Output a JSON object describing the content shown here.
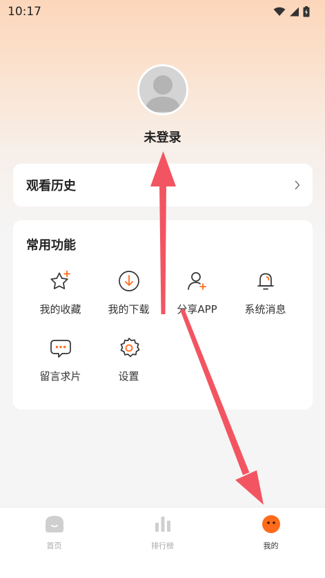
{
  "status_bar": {
    "time": "10:17"
  },
  "profile": {
    "username": "未登录"
  },
  "history": {
    "title": "观看历史"
  },
  "features": {
    "title": "常用功能",
    "items": [
      {
        "label": "我的收藏",
        "icon": "star-plus-icon"
      },
      {
        "label": "我的下载",
        "icon": "download-icon"
      },
      {
        "label": "分享APP",
        "icon": "user-plus-icon"
      },
      {
        "label": "系统消息",
        "icon": "bell-icon"
      },
      {
        "label": "留言求片",
        "icon": "message-icon"
      },
      {
        "label": "设置",
        "icon": "gear-icon"
      }
    ]
  },
  "tabbar": {
    "tabs": [
      {
        "label": "首页",
        "icon": "home-icon",
        "active": false
      },
      {
        "label": "排行榜",
        "icon": "ranking-icon",
        "active": false
      },
      {
        "label": "我的",
        "icon": "mine-icon",
        "active": true
      }
    ]
  },
  "colors": {
    "accent": "#ff6b1a",
    "annotation_arrow": "#f25561"
  }
}
